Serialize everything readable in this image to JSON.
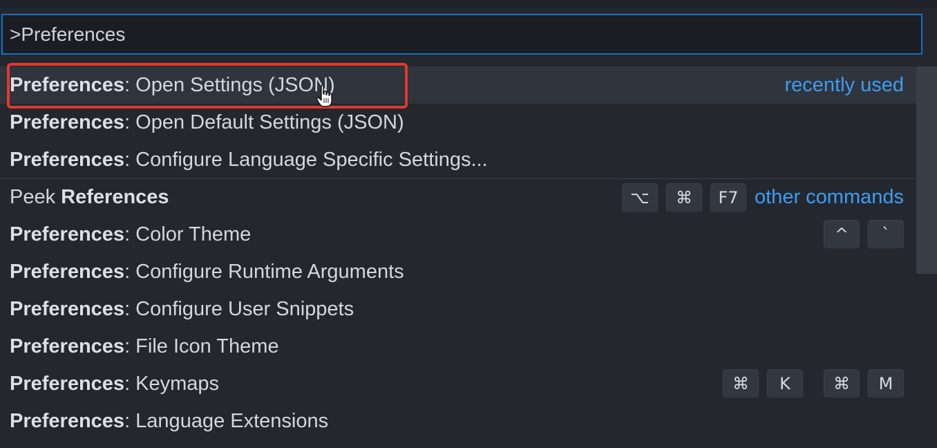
{
  "search": {
    "value": ">Preferences"
  },
  "items": [
    {
      "prefix": "Preferences",
      "rest": ": Open Settings (JSON)",
      "hint": "recently used"
    },
    {
      "prefix": "Preferences",
      "rest": ": Open Default Settings (JSON)"
    },
    {
      "prefix": "Preferences",
      "rest": ": Configure Language Specific Settings..."
    },
    {
      "lead": "Peek ",
      "prefix": "References",
      "keys": [
        "⌥",
        "⌘",
        "F7"
      ],
      "hint": "other commands"
    },
    {
      "prefix": "Preferences",
      "rest": ": Color Theme",
      "keys": [
        "^",
        "`"
      ]
    },
    {
      "prefix": "Preferences",
      "rest": ": Configure Runtime Arguments"
    },
    {
      "prefix": "Preferences",
      "rest": ": Configure User Snippets"
    },
    {
      "prefix": "Preferences",
      "rest": ": File Icon Theme"
    },
    {
      "prefix": "Preferences",
      "rest": ": Keymaps",
      "keys": [
        "⌘",
        "K",
        "⌘",
        "M"
      ]
    },
    {
      "prefix": "Preferences",
      "rest": ": Language Extensions"
    }
  ],
  "colors": {
    "accent": "#3d9df2",
    "highlight_box": "#e0392f",
    "input_border": "#0e74c9"
  },
  "icons": {
    "cursor": "hand-pointer-icon"
  }
}
